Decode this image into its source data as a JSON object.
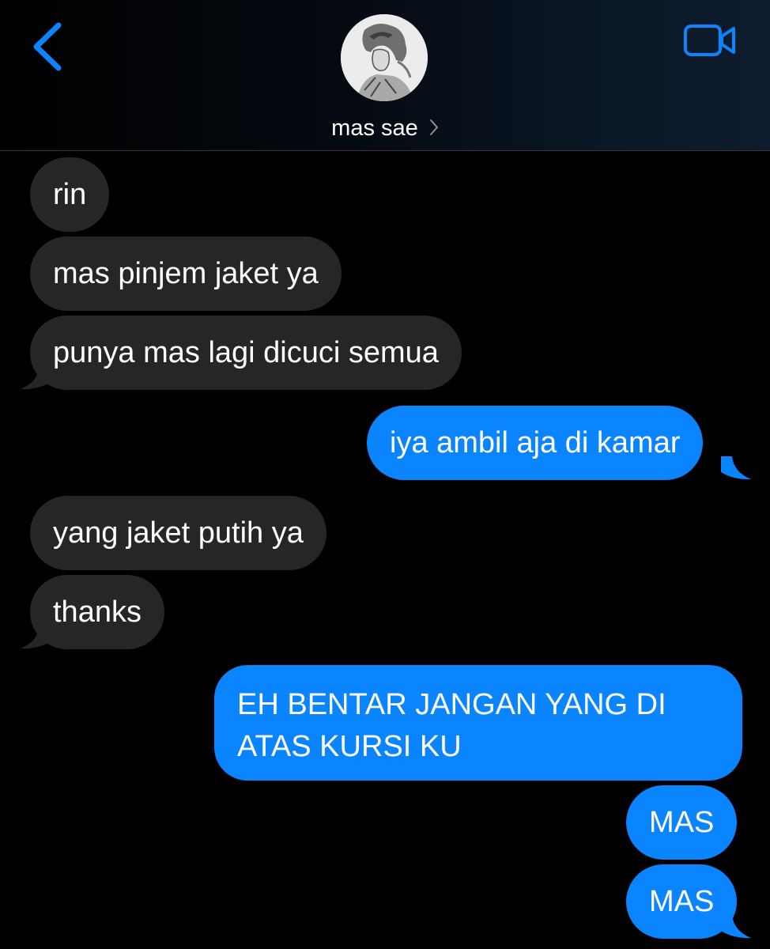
{
  "header": {
    "contact_name": "mas sae",
    "back_icon": "chevron-left-icon",
    "video_icon": "video-camera-icon",
    "accent_color": "#0a84ff"
  },
  "messages": [
    {
      "direction": "incoming",
      "text": "rin"
    },
    {
      "direction": "incoming",
      "text": "mas pinjem jaket ya"
    },
    {
      "direction": "incoming",
      "text": "punya mas lagi dicuci semua"
    },
    {
      "direction": "outgoing",
      "text": "iya ambil aja di kamar"
    },
    {
      "direction": "incoming",
      "text": "yang jaket putih ya"
    },
    {
      "direction": "incoming",
      "text": "thanks"
    },
    {
      "direction": "outgoing",
      "text": "EH BENTAR JANGAN YANG DI ATAS KURSI KU"
    },
    {
      "direction": "outgoing",
      "text": "MAS"
    },
    {
      "direction": "outgoing",
      "text": "MAS"
    }
  ],
  "colors": {
    "incoming_bubble": "#262628",
    "outgoing_bubble": "#0a84ff",
    "background": "#000000"
  }
}
